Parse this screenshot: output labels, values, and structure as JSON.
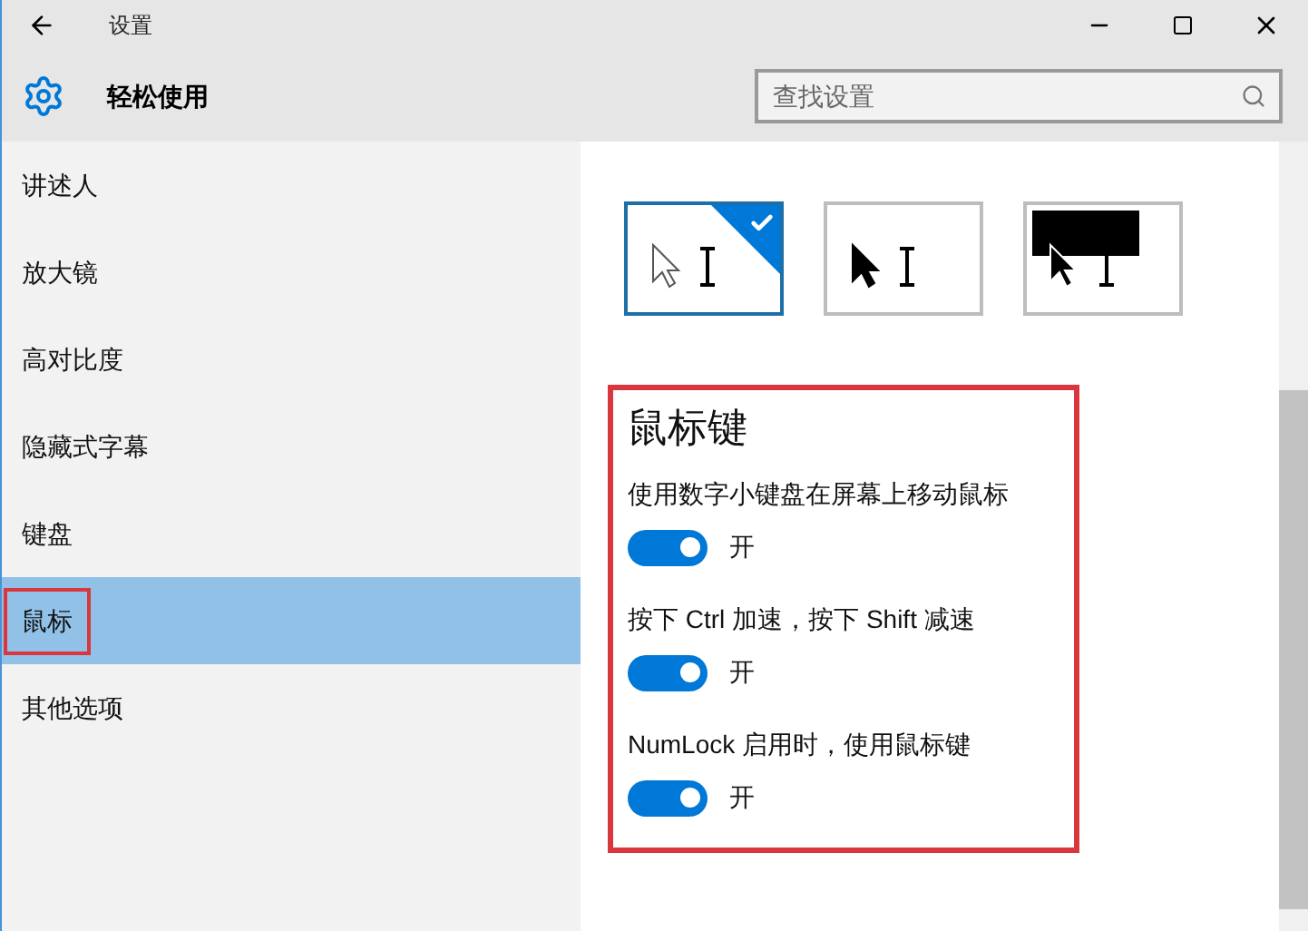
{
  "window": {
    "title": "设置"
  },
  "header": {
    "title": "轻松使用",
    "search": {
      "placeholder": "查找设置"
    }
  },
  "sidebar": {
    "items": [
      {
        "label": "讲述人",
        "selected": false,
        "marked": false
      },
      {
        "label": "放大镜",
        "selected": false,
        "marked": false
      },
      {
        "label": "高对比度",
        "selected": false,
        "marked": false
      },
      {
        "label": "隐藏式字幕",
        "selected": false,
        "marked": false
      },
      {
        "label": "键盘",
        "selected": false,
        "marked": false
      },
      {
        "label": "鼠标",
        "selected": true,
        "marked": true
      },
      {
        "label": "其他选项",
        "selected": false,
        "marked": false
      }
    ]
  },
  "pointer_colors": [
    {
      "kind": "white",
      "selected": true
    },
    {
      "kind": "black",
      "selected": false
    },
    {
      "kind": "inverted",
      "selected": false
    }
  ],
  "mouse_keys": {
    "title": "鼠标键",
    "marked": true,
    "settings": [
      {
        "label": "使用数字小键盘在屏幕上移动鼠标",
        "on": true,
        "state_text": "开"
      },
      {
        "label": "按下 Ctrl 加速，按下 Shift 减速",
        "on": true,
        "state_text": "开"
      },
      {
        "label": "NumLock 启用时，使用鼠标键",
        "on": true,
        "state_text": "开"
      }
    ]
  }
}
